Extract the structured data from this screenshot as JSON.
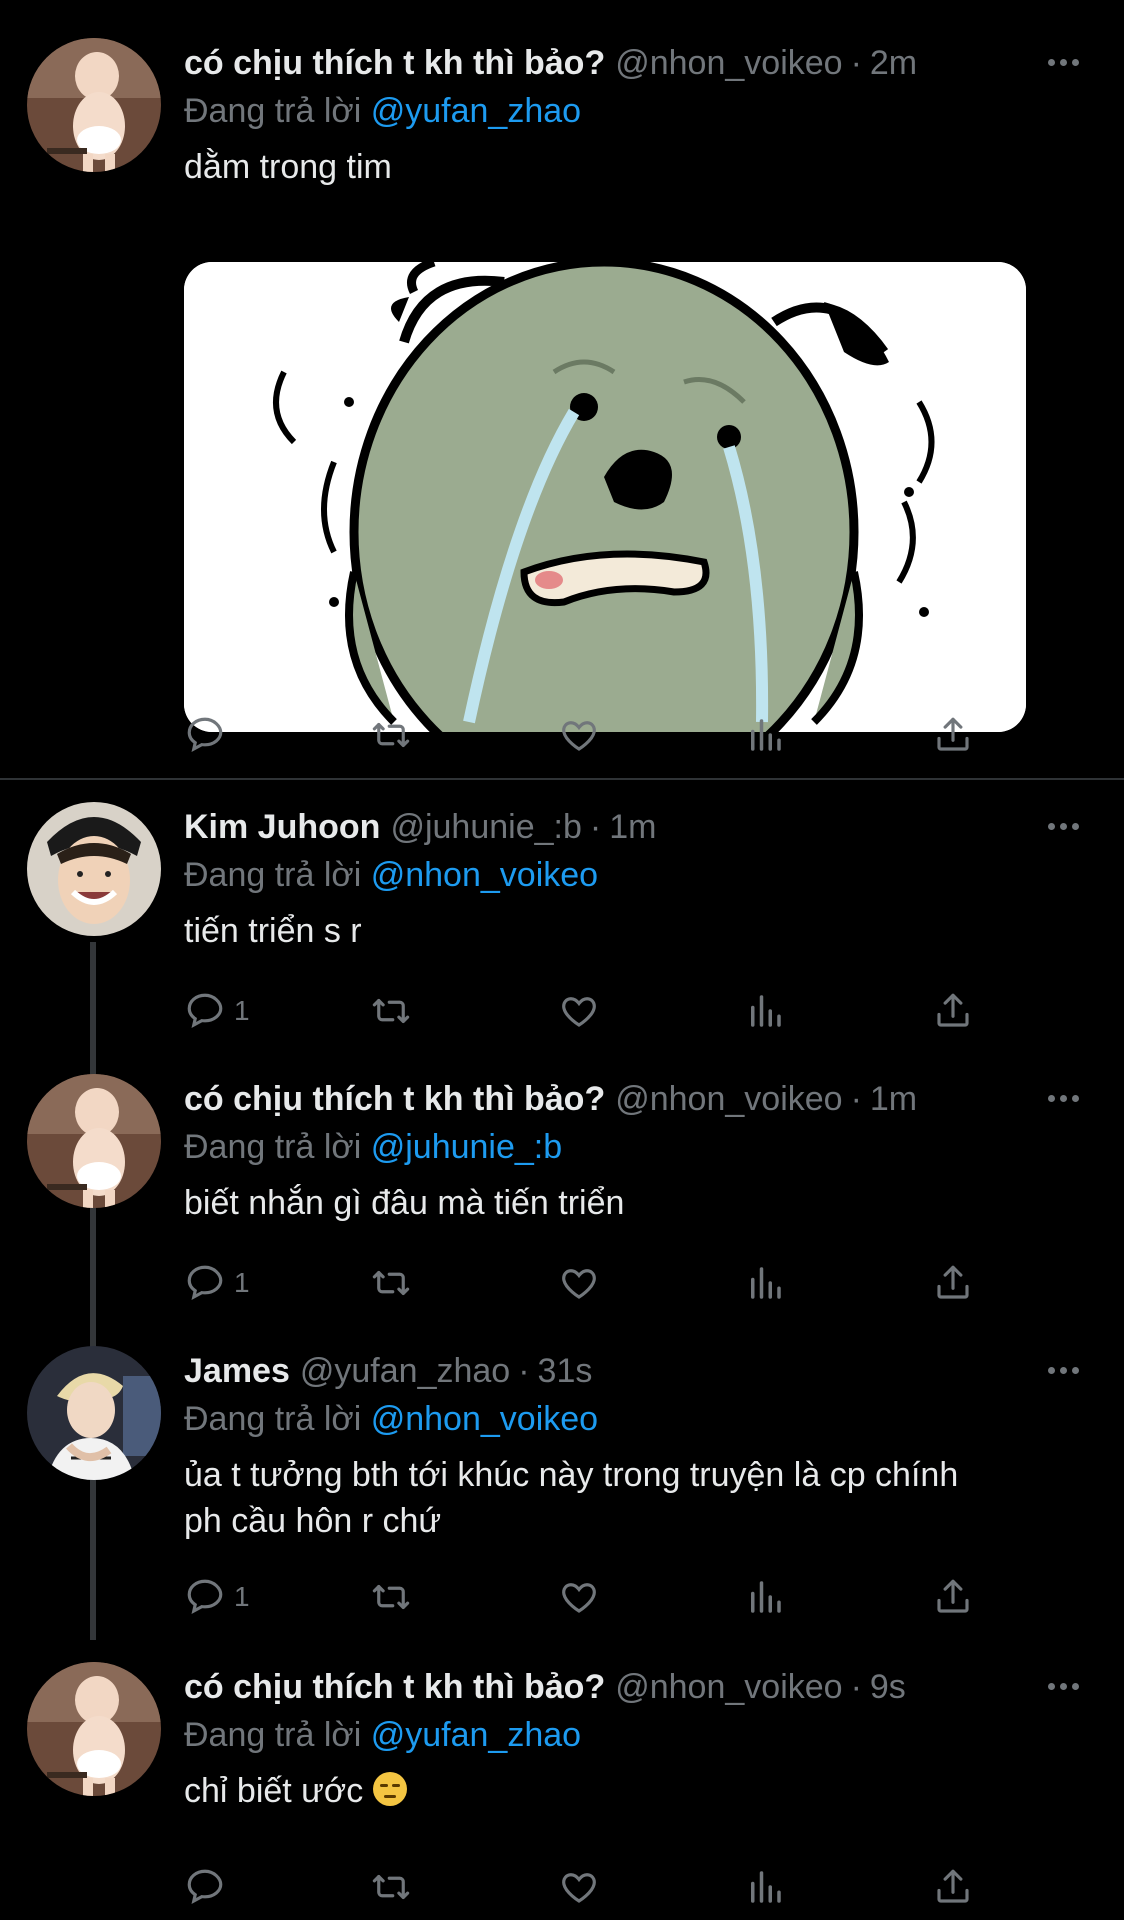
{
  "tweets": [
    {
      "name": "có chịu thích t kh thì bảo?",
      "handle": "@nhon_voikeo",
      "time": "2m",
      "replying_prefix": "Đang trả lời",
      "replying_to": "@yufan_zhao",
      "text": "dằm trong tim",
      "reply_count": "",
      "avatar": "baby-avatar"
    },
    {
      "name": "Kim Juhoon",
      "handle": "@juhunie_:b",
      "time": "1m",
      "replying_prefix": "Đang trả lời",
      "replying_to": "@nhon_voikeo",
      "text": "tiến triển s r",
      "reply_count": "1",
      "avatar": "smiling-person-avatar"
    },
    {
      "name": "có chịu thích t kh thì bảo?",
      "handle": "@nhon_voikeo",
      "time": "1m",
      "replying_prefix": "Đang trả lời",
      "replying_to": "@juhunie_:b",
      "text": "biết nhắn gì đâu mà tiến triển",
      "reply_count": "1",
      "avatar": "baby-avatar"
    },
    {
      "name": "James",
      "handle": "@yufan_zhao",
      "time": "31s",
      "replying_prefix": "Đang trả lời",
      "replying_to": "@nhon_voikeo",
      "text_line1": "ủa t tưởng bth tới khúc này trong truyện là cp chính",
      "text_line2": "ph cầu hôn r chứ",
      "reply_count": "1",
      "avatar": "blond-person-avatar"
    },
    {
      "name": "có chịu thích t kh thì bảo?",
      "handle": "@nhon_voikeo",
      "time": "9s",
      "replying_prefix": "Đang trả lời",
      "replying_to": "@yufan_zhao",
      "text": "chỉ biết ước",
      "emoji": "pensive-face-emoji",
      "reply_count": "",
      "avatar": "baby-avatar"
    }
  ],
  "separator": "·",
  "icons": {
    "reply": "reply-icon",
    "retweet": "retweet-icon",
    "like": "like-icon",
    "views": "views-icon",
    "share": "share-icon",
    "more": "more-icon"
  },
  "colors": {
    "background": "#000000",
    "text": "#e7e9ea",
    "muted": "#71767b",
    "mention": "#1d9bf0",
    "thread_line": "#333639"
  },
  "media_image": "crying-green-dog-sticker"
}
